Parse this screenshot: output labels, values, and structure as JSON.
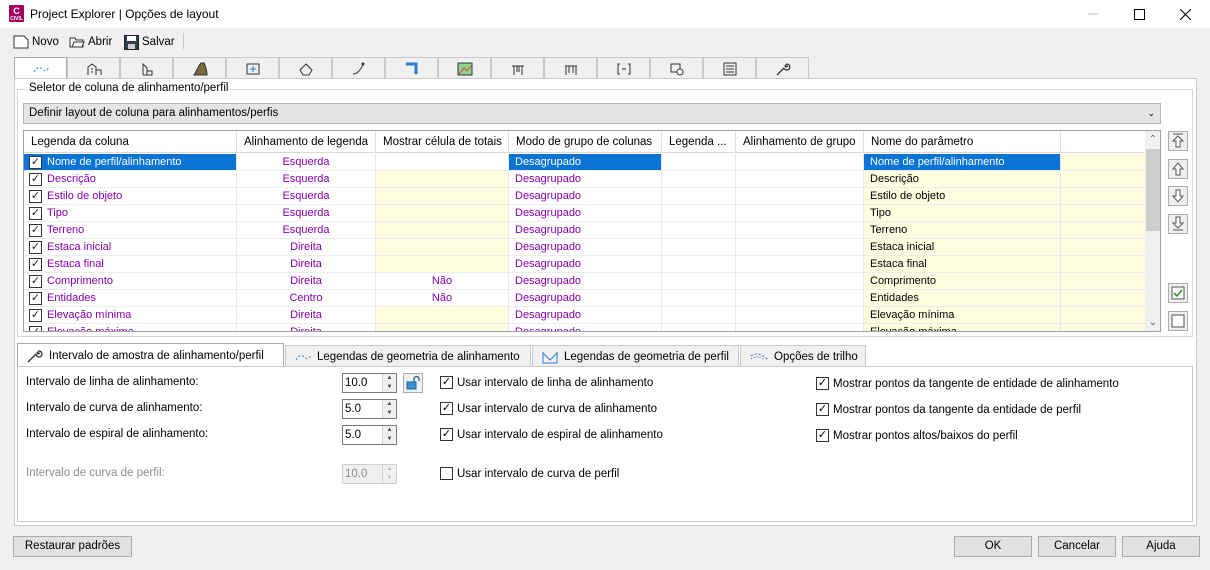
{
  "window": {
    "title": "Project Explorer | Opções de layout",
    "app_icon_letter": "C",
    "app_icon_sub": "CIVIL"
  },
  "toolbar": {
    "new_label": "Novo",
    "open_label": "Abrir",
    "save_label": "Salvar"
  },
  "main_tabs": [
    "alignment-tab-icon",
    "station-tab-icon",
    "profile-tab-icon",
    "road-tab-icon",
    "surface-tab-icon",
    "site-tab-icon",
    "corridor-tab-icon",
    "section-tab-icon",
    "image-tab-icon",
    "structure-tab-icon",
    "pipe-tab-icon",
    "bracket-tab-icon",
    "view-tab-icon",
    "list-tab-icon",
    "wrench-tab-icon"
  ],
  "group": {
    "label": "Seletor de coluna de alinhamento/perfil",
    "combo_value": "Definir layout de coluna para alinhamentos/perfis"
  },
  "grid": {
    "columns": [
      "Legenda da coluna",
      "Alinhamento de legenda",
      "Mostrar célula de totais",
      "Modo de grupo de colunas",
      "Legenda ...",
      "Alinhamento de grupo",
      "Nome do parâmetro"
    ],
    "rows": [
      {
        "legend": "Nome de perfil/alinhamento",
        "align": "Esquerda",
        "totals": "",
        "mode": "Desagrupado",
        "param": "Nome de perfil/alinhamento",
        "checked": true,
        "selected": true,
        "totals_yellow": false
      },
      {
        "legend": "Descrição",
        "align": "Esquerda",
        "totals": "",
        "mode": "Desagrupado",
        "param": "Descrição",
        "checked": true,
        "selected": false,
        "totals_yellow": true
      },
      {
        "legend": "Estilo de objeto",
        "align": "Esquerda",
        "totals": "",
        "mode": "Desagrupado",
        "param": "Estilo de objeto",
        "checked": true,
        "selected": false,
        "totals_yellow": true
      },
      {
        "legend": "Tipo",
        "align": "Esquerda",
        "totals": "",
        "mode": "Desagrupado",
        "param": "Tipo",
        "checked": true,
        "selected": false,
        "totals_yellow": true
      },
      {
        "legend": "Terreno",
        "align": "Esquerda",
        "totals": "",
        "mode": "Desagrupado",
        "param": "Terreno",
        "checked": true,
        "selected": false,
        "totals_yellow": true
      },
      {
        "legend": "Estaca inicial",
        "align": "Direita",
        "totals": "",
        "mode": "Desagrupado",
        "param": "Estaca inicial",
        "checked": true,
        "selected": false,
        "totals_yellow": true
      },
      {
        "legend": "Estaca final",
        "align": "Direita",
        "totals": "",
        "mode": "Desagrupado",
        "param": "Estaca final",
        "checked": true,
        "selected": false,
        "totals_yellow": true
      },
      {
        "legend": "Comprimento",
        "align": "Direita",
        "totals": "Não",
        "mode": "Desagrupado",
        "param": "Comprimento",
        "checked": true,
        "selected": false,
        "totals_yellow": false
      },
      {
        "legend": "Entidades",
        "align": "Centro",
        "totals": "Não",
        "mode": "Desagrupado",
        "param": "Entidades",
        "checked": true,
        "selected": false,
        "totals_yellow": false
      },
      {
        "legend": "Elevação mínima",
        "align": "Direita",
        "totals": "",
        "mode": "Desagrupado",
        "param": "Elevação mínima",
        "checked": true,
        "selected": false,
        "totals_yellow": true
      },
      {
        "legend": "Elevação máxima",
        "align": "Direita",
        "totals": "",
        "mode": "Desagrupado",
        "param": "Elevação máxima",
        "checked": true,
        "selected": false,
        "totals_yellow": true
      }
    ]
  },
  "bottom_tabs": [
    {
      "label": "Intervalo de amostra de alinhamento/perfil",
      "icon": "wrench-icon"
    },
    {
      "label": "Legendas de geometria de alinhamento",
      "icon": "alignment-icon"
    },
    {
      "label": "Legendas de geometria de perfil",
      "icon": "profile-icon"
    },
    {
      "label": "Opções de trilho",
      "icon": "rail-icon"
    }
  ],
  "intervals": {
    "line_label": "Intervalo de linha de alinhamento:",
    "line_value": "10.0",
    "curve_label": "Intervalo de curva de alinhamento:",
    "curve_value": "5.0",
    "spiral_label": "Intervalo de espiral de alinhamento:",
    "spiral_value": "5.0",
    "profile_curve_label": "Intervalo de curva de perfil:",
    "profile_curve_value": "10.0"
  },
  "checks": {
    "use_line": "Usar intervalo de linha de alinhamento",
    "use_curve": "Usar intervalo de curva de alinhamento",
    "use_spiral": "Usar intervalo de espiral de alinhamento",
    "use_profile_curve": "Usar intervalo de curva de perfil",
    "show_alignment_tangent": "Mostrar pontos da tangente de entidade de alinhamento",
    "show_profile_tangent": "Mostrar pontos da tangente da entidade de perfil",
    "show_high_low": "Mostrar pontos altos/baixos do perfil"
  },
  "footer": {
    "restore_label": "Restaurar padrões",
    "ok_label": "OK",
    "cancel_label": "Cancelar",
    "help_label": "Ajuda"
  },
  "colors": {
    "accent": "#0a74d6",
    "value_text": "#8800aa",
    "highlight_cell": "#fffde0",
    "brand": "#a0005e"
  }
}
